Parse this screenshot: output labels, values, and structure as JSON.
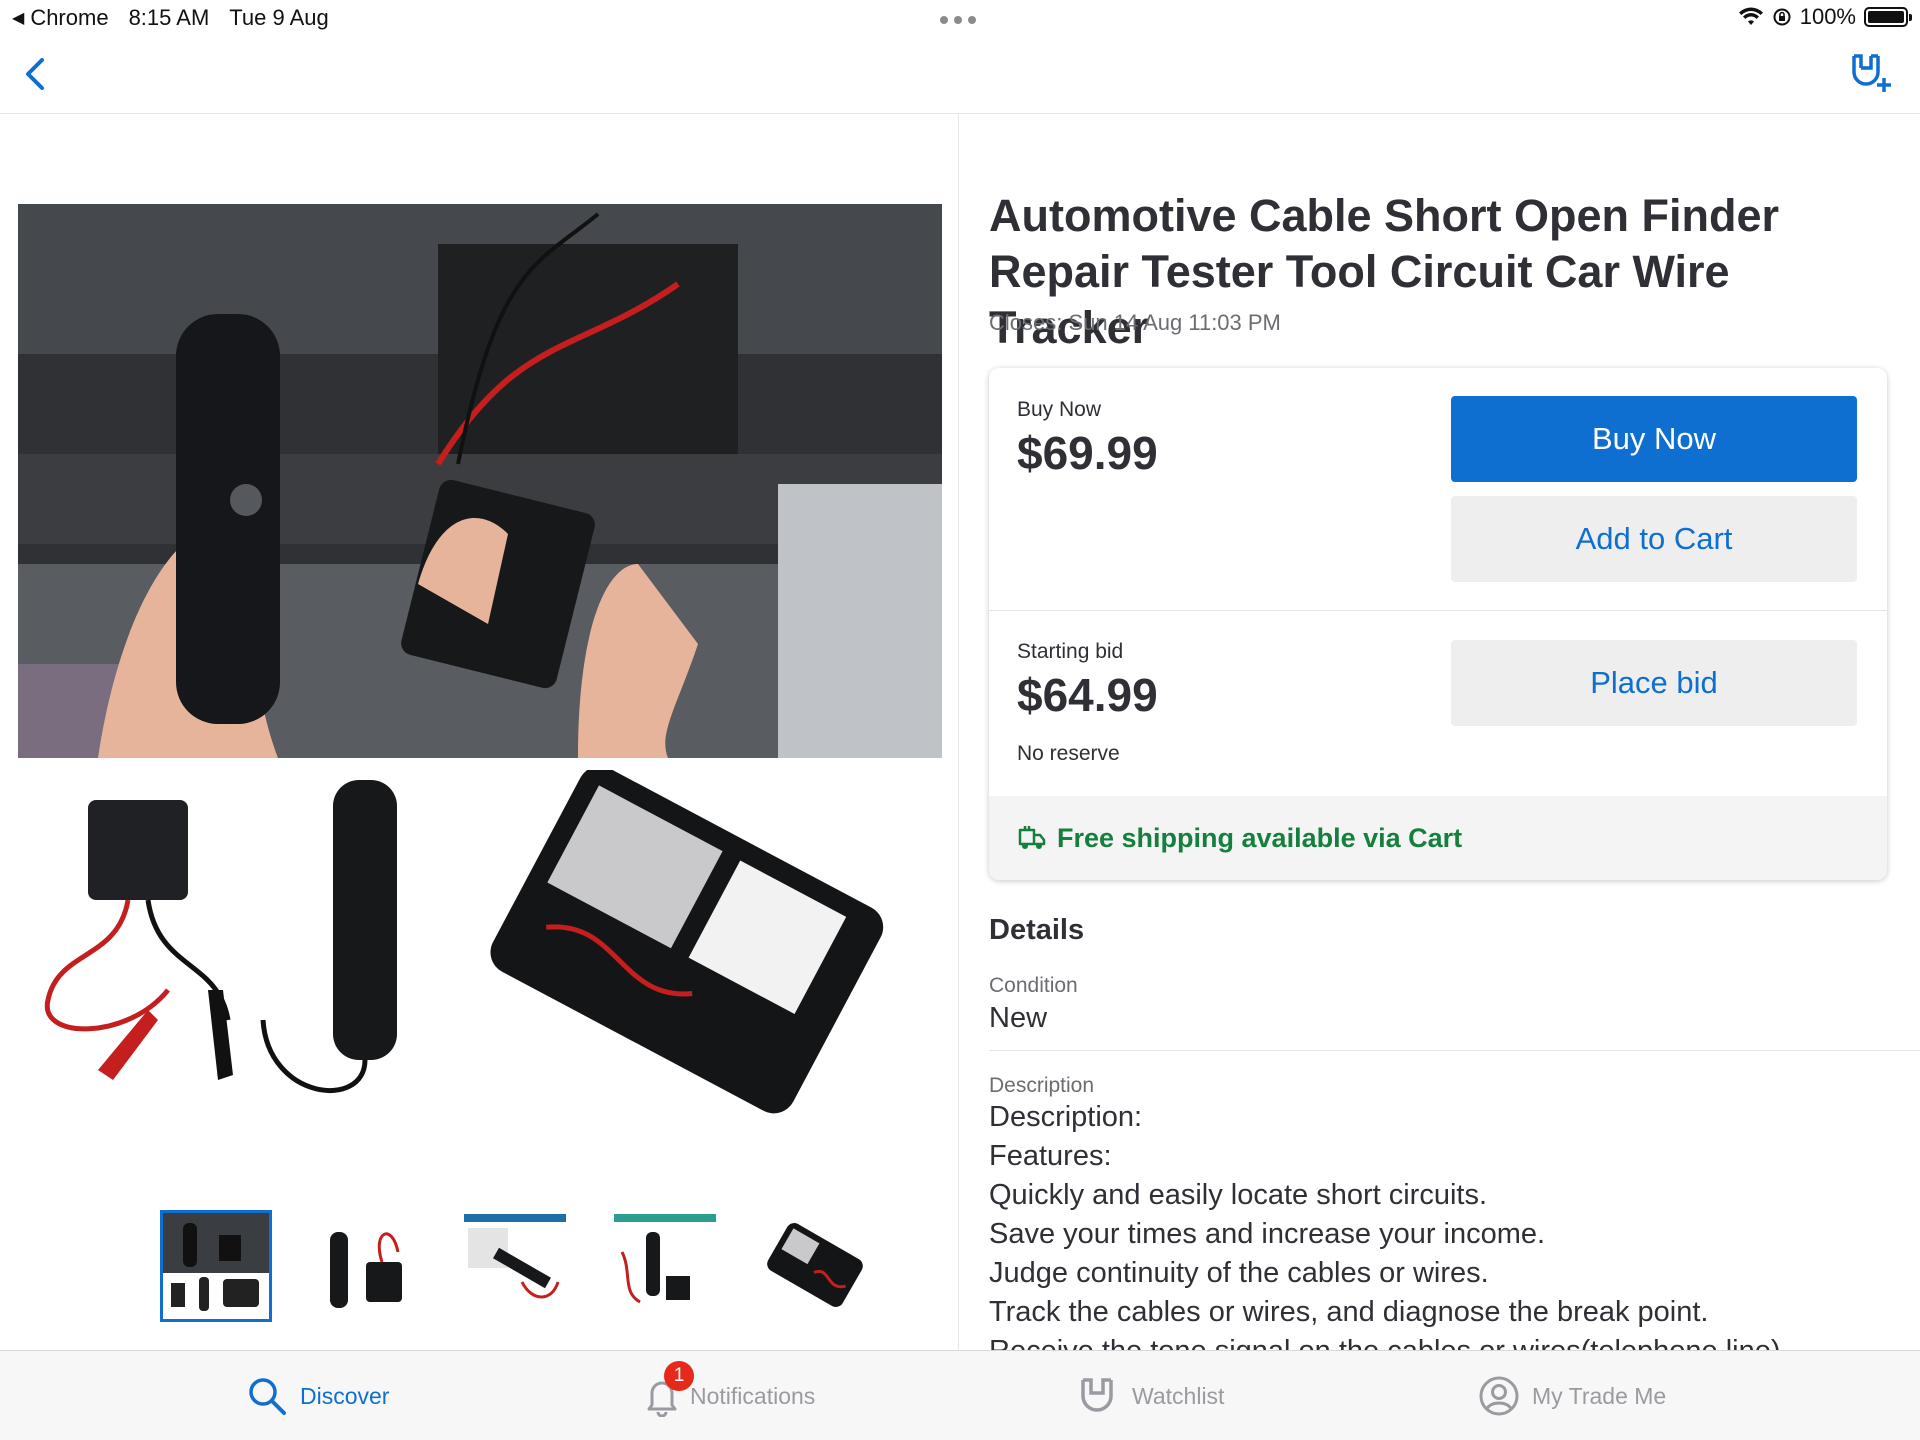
{
  "status_bar": {
    "app": "Chrome",
    "time": "8:15 AM",
    "date": "Tue 9 Aug",
    "battery": "100%"
  },
  "nav": {
    "back_icon": "chevron-left-icon",
    "watch_icon": "watchlist-add-icon"
  },
  "listing": {
    "title": "Automotive Cable Short Open Finder Repair Tester Tool Circuit Car Wire Tracker",
    "closes": "Closes: Sun 14 Aug 11:03 PM",
    "buy_now_label": "Buy Now",
    "buy_now_price": "$69.99",
    "buy_now_button": "Buy Now",
    "add_to_cart_button": "Add to Cart",
    "starting_bid_label": "Starting bid",
    "starting_bid_price": "$64.99",
    "reserve": "No reserve",
    "place_bid_button": "Place bid",
    "shipping": "Free shipping available via Cart"
  },
  "details": {
    "heading": "Details",
    "condition_label": "Condition",
    "condition_value": "New",
    "description_label": "Description",
    "description_lines": [
      "Description:",
      "Features:",
      "Quickly and easily locate short circuits.",
      "Save your times and increase your income.",
      "Judge continuity of the cables or wires.",
      "Track the cables or wires, and diagnose the break point.",
      "Receive the tone signal on the cables or wires(telephone line)."
    ]
  },
  "gallery": {
    "thumb_count": 5,
    "selected_thumb": 1
  },
  "tabs": [
    {
      "label": "Discover",
      "icon": "search-icon",
      "active": true
    },
    {
      "label": "Notifications",
      "icon": "bell-icon",
      "badge": "1"
    },
    {
      "label": "Watchlist",
      "icon": "watchlist-icon"
    },
    {
      "label": "My Trade Me",
      "icon": "user-circle-icon"
    }
  ],
  "colors": {
    "accent": "#0f6fd1",
    "shipping_green": "#15803d",
    "badge_red": "#e52a1c"
  }
}
